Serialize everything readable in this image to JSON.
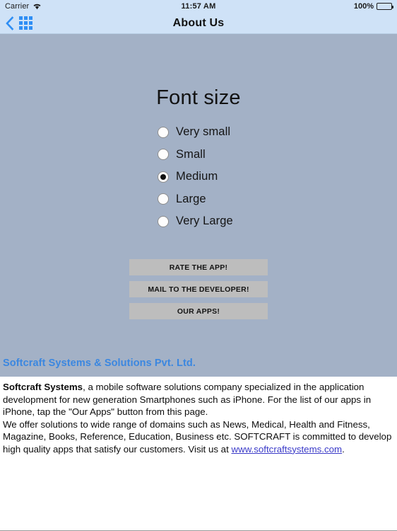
{
  "status_bar": {
    "carrier": "Carrier",
    "wifi_icon": "wifi-icon",
    "time": "11:57 AM",
    "battery_percent": "100%",
    "battery_icon": "battery-full-icon"
  },
  "nav_bar": {
    "back_icon": "back-chevron-icon",
    "grid_icon": "grid-apps-icon",
    "title": "About Us"
  },
  "settings_panel": {
    "heading": "Font size",
    "options": [
      {
        "label": "Very small",
        "selected": false
      },
      {
        "label": "Small",
        "selected": false
      },
      {
        "label": "Medium",
        "selected": true
      },
      {
        "label": "Large",
        "selected": false
      },
      {
        "label": "Very Large",
        "selected": false
      }
    ],
    "buttons": [
      {
        "label": "RATE THE APP!"
      },
      {
        "label": "MAIL TO THE DEVELOPER!"
      },
      {
        "label": "OUR APPS!"
      }
    ],
    "company_name": "Softcraft Systems & Solutions Pvt. Ltd."
  },
  "about_text": {
    "para1_bold": "Softcraft Systems",
    "para1_rest": ", a mobile software solutions company specialized in the application development for new generation Smartphones such as iPhone. For the list of our apps in iPhone, tap the \"Our Apps\" button from this page.",
    "para2_before_link": "We offer solutions to wide range of domains such as News, Medical, Health and Fitness, Magazine, Books, Reference, Education, Business etc. SOFTCRAFT is committed to develop high quality apps that satisfy our customers. Visit us at ",
    "link_text": "www.softcraftsystems.com",
    "para2_after_link": "."
  },
  "colors": {
    "status_nav_bg": "#cfe2f7",
    "panel_bg": "#a3b1c6",
    "button_bg": "#bdbdbd",
    "accent_blue": "#3b87e0",
    "icon_blue": "#2f8ef4",
    "link_blue": "#3a3ac8"
  }
}
